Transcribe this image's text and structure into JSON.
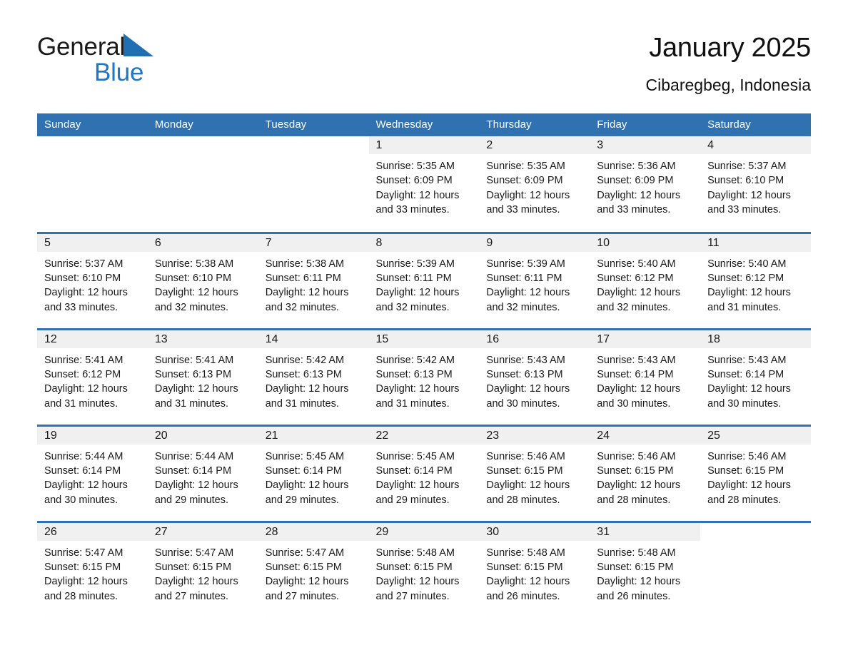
{
  "logo": {
    "word1": "General",
    "word2": "Blue",
    "triangle_color": "#1f6fb2",
    "word2_color": "#1f77c4"
  },
  "header": {
    "title": "January 2025",
    "subtitle": "Cibaregbeg, Indonesia"
  },
  "theme": {
    "header_blue": "#3071b2",
    "daynum_band": "#f0f0f0",
    "text": "#1a1a1a"
  },
  "weekday_headers": [
    "Sunday",
    "Monday",
    "Tuesday",
    "Wednesday",
    "Thursday",
    "Friday",
    "Saturday"
  ],
  "weeks": [
    [
      {
        "day": "",
        "sunrise": "",
        "sunset": "",
        "daylight": ""
      },
      {
        "day": "",
        "sunrise": "",
        "sunset": "",
        "daylight": ""
      },
      {
        "day": "",
        "sunrise": "",
        "sunset": "",
        "daylight": ""
      },
      {
        "day": "1",
        "sunrise": "Sunrise: 5:35 AM",
        "sunset": "Sunset: 6:09 PM",
        "daylight": "Daylight: 12 hours and 33 minutes."
      },
      {
        "day": "2",
        "sunrise": "Sunrise: 5:35 AM",
        "sunset": "Sunset: 6:09 PM",
        "daylight": "Daylight: 12 hours and 33 minutes."
      },
      {
        "day": "3",
        "sunrise": "Sunrise: 5:36 AM",
        "sunset": "Sunset: 6:09 PM",
        "daylight": "Daylight: 12 hours and 33 minutes."
      },
      {
        "day": "4",
        "sunrise": "Sunrise: 5:37 AM",
        "sunset": "Sunset: 6:10 PM",
        "daylight": "Daylight: 12 hours and 33 minutes."
      }
    ],
    [
      {
        "day": "5",
        "sunrise": "Sunrise: 5:37 AM",
        "sunset": "Sunset: 6:10 PM",
        "daylight": "Daylight: 12 hours and 33 minutes."
      },
      {
        "day": "6",
        "sunrise": "Sunrise: 5:38 AM",
        "sunset": "Sunset: 6:10 PM",
        "daylight": "Daylight: 12 hours and 32 minutes."
      },
      {
        "day": "7",
        "sunrise": "Sunrise: 5:38 AM",
        "sunset": "Sunset: 6:11 PM",
        "daylight": "Daylight: 12 hours and 32 minutes."
      },
      {
        "day": "8",
        "sunrise": "Sunrise: 5:39 AM",
        "sunset": "Sunset: 6:11 PM",
        "daylight": "Daylight: 12 hours and 32 minutes."
      },
      {
        "day": "9",
        "sunrise": "Sunrise: 5:39 AM",
        "sunset": "Sunset: 6:11 PM",
        "daylight": "Daylight: 12 hours and 32 minutes."
      },
      {
        "day": "10",
        "sunrise": "Sunrise: 5:40 AM",
        "sunset": "Sunset: 6:12 PM",
        "daylight": "Daylight: 12 hours and 32 minutes."
      },
      {
        "day": "11",
        "sunrise": "Sunrise: 5:40 AM",
        "sunset": "Sunset: 6:12 PM",
        "daylight": "Daylight: 12 hours and 31 minutes."
      }
    ],
    [
      {
        "day": "12",
        "sunrise": "Sunrise: 5:41 AM",
        "sunset": "Sunset: 6:12 PM",
        "daylight": "Daylight: 12 hours and 31 minutes."
      },
      {
        "day": "13",
        "sunrise": "Sunrise: 5:41 AM",
        "sunset": "Sunset: 6:13 PM",
        "daylight": "Daylight: 12 hours and 31 minutes."
      },
      {
        "day": "14",
        "sunrise": "Sunrise: 5:42 AM",
        "sunset": "Sunset: 6:13 PM",
        "daylight": "Daylight: 12 hours and 31 minutes."
      },
      {
        "day": "15",
        "sunrise": "Sunrise: 5:42 AM",
        "sunset": "Sunset: 6:13 PM",
        "daylight": "Daylight: 12 hours and 31 minutes."
      },
      {
        "day": "16",
        "sunrise": "Sunrise: 5:43 AM",
        "sunset": "Sunset: 6:13 PM",
        "daylight": "Daylight: 12 hours and 30 minutes."
      },
      {
        "day": "17",
        "sunrise": "Sunrise: 5:43 AM",
        "sunset": "Sunset: 6:14 PM",
        "daylight": "Daylight: 12 hours and 30 minutes."
      },
      {
        "day": "18",
        "sunrise": "Sunrise: 5:43 AM",
        "sunset": "Sunset: 6:14 PM",
        "daylight": "Daylight: 12 hours and 30 minutes."
      }
    ],
    [
      {
        "day": "19",
        "sunrise": "Sunrise: 5:44 AM",
        "sunset": "Sunset: 6:14 PM",
        "daylight": "Daylight: 12 hours and 30 minutes."
      },
      {
        "day": "20",
        "sunrise": "Sunrise: 5:44 AM",
        "sunset": "Sunset: 6:14 PM",
        "daylight": "Daylight: 12 hours and 29 minutes."
      },
      {
        "day": "21",
        "sunrise": "Sunrise: 5:45 AM",
        "sunset": "Sunset: 6:14 PM",
        "daylight": "Daylight: 12 hours and 29 minutes."
      },
      {
        "day": "22",
        "sunrise": "Sunrise: 5:45 AM",
        "sunset": "Sunset: 6:14 PM",
        "daylight": "Daylight: 12 hours and 29 minutes."
      },
      {
        "day": "23",
        "sunrise": "Sunrise: 5:46 AM",
        "sunset": "Sunset: 6:15 PM",
        "daylight": "Daylight: 12 hours and 28 minutes."
      },
      {
        "day": "24",
        "sunrise": "Sunrise: 5:46 AM",
        "sunset": "Sunset: 6:15 PM",
        "daylight": "Daylight: 12 hours and 28 minutes."
      },
      {
        "day": "25",
        "sunrise": "Sunrise: 5:46 AM",
        "sunset": "Sunset: 6:15 PM",
        "daylight": "Daylight: 12 hours and 28 minutes."
      }
    ],
    [
      {
        "day": "26",
        "sunrise": "Sunrise: 5:47 AM",
        "sunset": "Sunset: 6:15 PM",
        "daylight": "Daylight: 12 hours and 28 minutes."
      },
      {
        "day": "27",
        "sunrise": "Sunrise: 5:47 AM",
        "sunset": "Sunset: 6:15 PM",
        "daylight": "Daylight: 12 hours and 27 minutes."
      },
      {
        "day": "28",
        "sunrise": "Sunrise: 5:47 AM",
        "sunset": "Sunset: 6:15 PM",
        "daylight": "Daylight: 12 hours and 27 minutes."
      },
      {
        "day": "29",
        "sunrise": "Sunrise: 5:48 AM",
        "sunset": "Sunset: 6:15 PM",
        "daylight": "Daylight: 12 hours and 27 minutes."
      },
      {
        "day": "30",
        "sunrise": "Sunrise: 5:48 AM",
        "sunset": "Sunset: 6:15 PM",
        "daylight": "Daylight: 12 hours and 26 minutes."
      },
      {
        "day": "31",
        "sunrise": "Sunrise: 5:48 AM",
        "sunset": "Sunset: 6:15 PM",
        "daylight": "Daylight: 12 hours and 26 minutes."
      },
      {
        "day": "",
        "sunrise": "",
        "sunset": "",
        "daylight": ""
      }
    ]
  ]
}
